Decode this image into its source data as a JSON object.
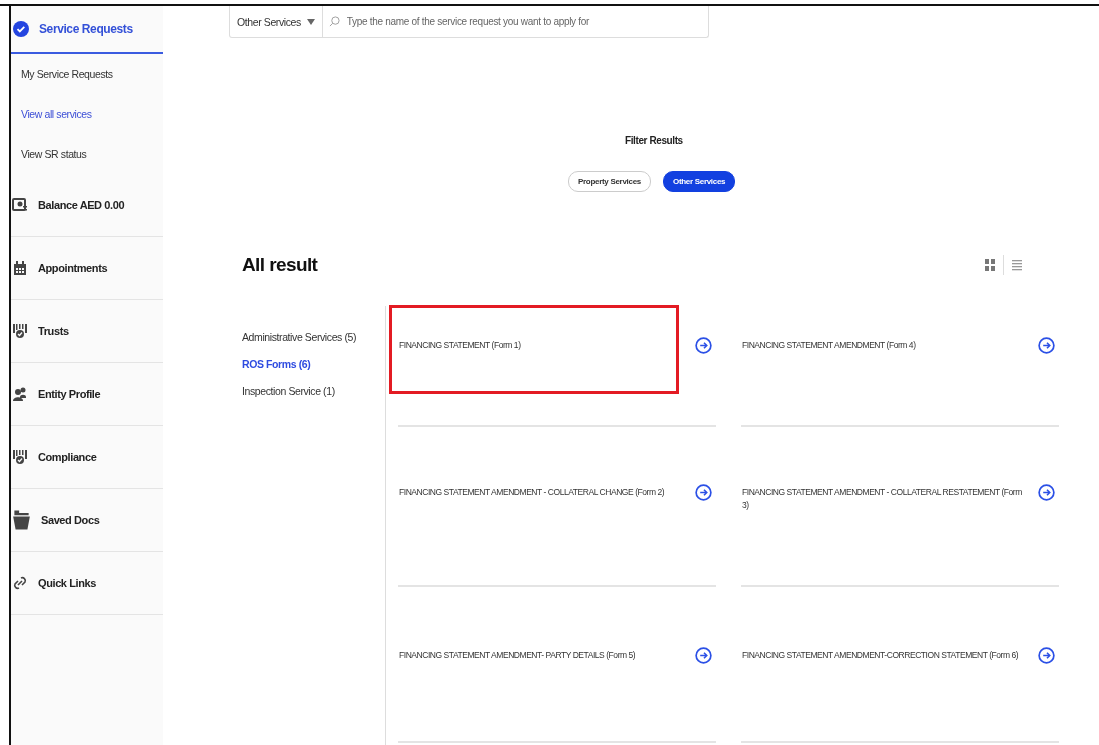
{
  "sidebar": {
    "header": {
      "label": "Service Requests",
      "selected": true
    },
    "sub_items": [
      {
        "label": "My Service Requests",
        "selected": false
      },
      {
        "label": "View all services",
        "selected": true
      },
      {
        "label": "View SR status",
        "selected": false
      }
    ],
    "sections": [
      {
        "label": "Balance AED 0.00",
        "kind": "wallet"
      },
      {
        "label": "Appointments",
        "kind": "calendar"
      },
      {
        "label": "Trusts",
        "kind": "shield"
      },
      {
        "label": "Entity Profile",
        "kind": "people"
      },
      {
        "label": "Compliance",
        "kind": "shield"
      },
      {
        "label": "Saved Docs",
        "kind": "folder"
      },
      {
        "label": "Quick Links",
        "kind": "link"
      }
    ]
  },
  "search": {
    "dropdown": "Other Services",
    "placeholder": "Type the name of the service request you want to apply for"
  },
  "filter": {
    "title": "Filter Results",
    "chips": [
      {
        "label": "Property Services",
        "selected": false
      },
      {
        "label": "Other Services",
        "selected": true
      }
    ]
  },
  "results": {
    "title": "All result",
    "categories": [
      {
        "label": "Administrative Services (5)",
        "selected": false
      },
      {
        "label": "ROS Forms (6)",
        "selected": true
      },
      {
        "label": "Inspection Service (1)",
        "selected": false
      }
    ],
    "cards": [
      {
        "label": "FINANCING STATEMENT (Form 1)",
        "highlighted": true
      },
      {
        "label": "FINANCING STATEMENT AMENDMENT (Form 4)",
        "highlighted": false
      },
      {
        "label": "FINANCING STATEMENT AMENDMENT - COLLATERAL CHANGE (Form 2)",
        "highlighted": false
      },
      {
        "label": "FINANCING STATEMENT AMENDMENT - COLLATERAL RESTATEMENT (Form 3)",
        "highlighted": false
      },
      {
        "label": "FINANCING STATEMENT AMENDMENT- PARTY DETAILS (Form 5)",
        "highlighted": false
      },
      {
        "label": "FINANCING STATEMENT AMENDMENT-CORRECTION STATEMENT (Form 6)",
        "highlighted": false
      }
    ]
  }
}
